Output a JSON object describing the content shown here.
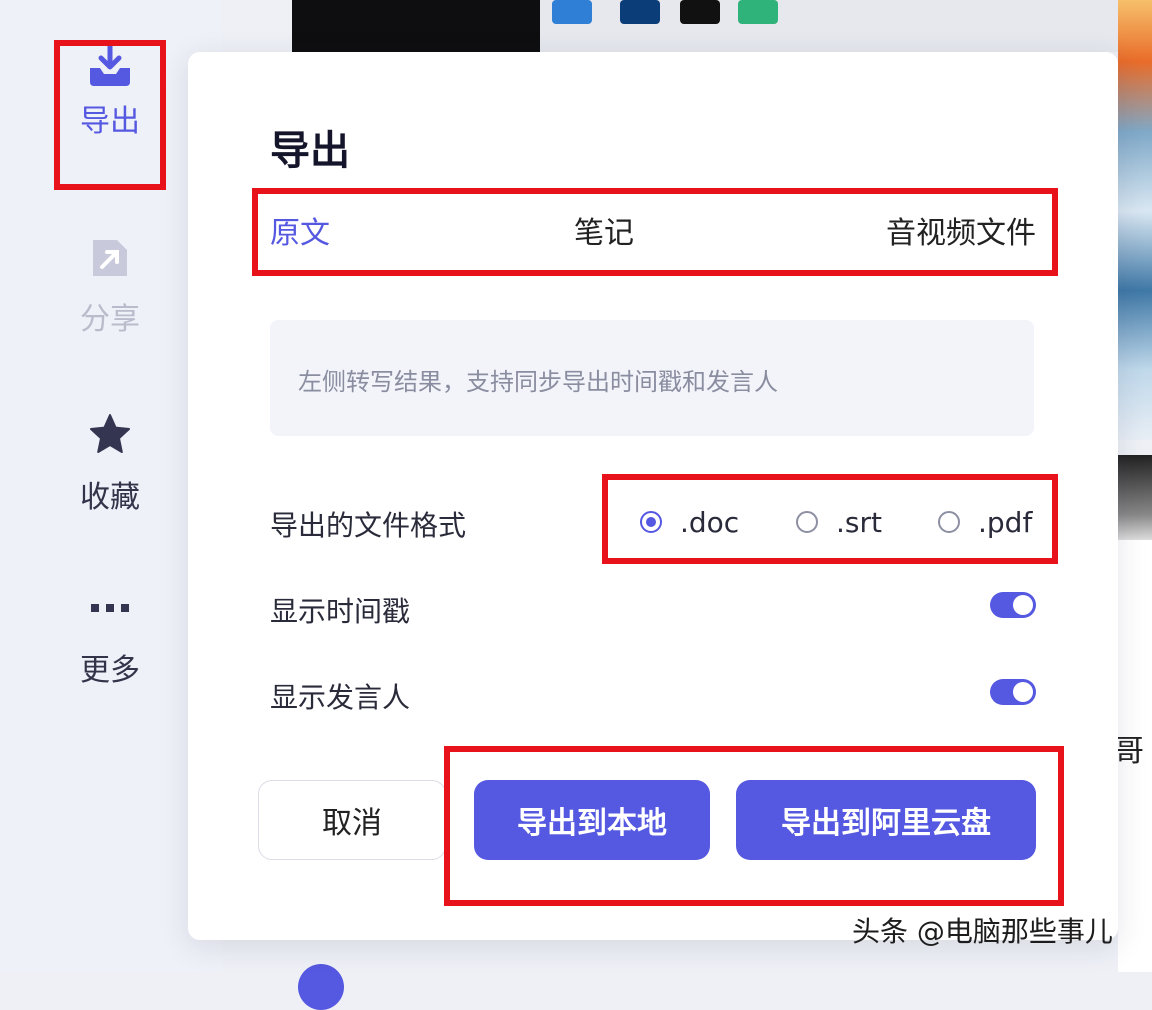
{
  "sidebar": {
    "items": [
      {
        "label": "导出",
        "icon": "download-tray-icon",
        "active": true
      },
      {
        "label": "分享",
        "icon": "share-arrow-icon",
        "disabled": true
      },
      {
        "label": "收藏",
        "icon": "star-icon"
      },
      {
        "label": "更多",
        "icon": "more-dots-icon"
      }
    ]
  },
  "dialog": {
    "title": "导出",
    "tabs": [
      {
        "label": "原文",
        "active": true
      },
      {
        "label": "笔记"
      },
      {
        "label": "音视频文件"
      }
    ],
    "description": "左侧转写结果，支持同步导出时间戳和发言人",
    "format": {
      "label": "导出的文件格式",
      "options": [
        ".doc",
        ".srt",
        ".pdf"
      ],
      "selected": ".doc"
    },
    "show_timestamp": {
      "label": "显示时间戳",
      "enabled": true
    },
    "show_speaker": {
      "label": "显示发言人",
      "enabled": true
    },
    "buttons": {
      "cancel": "取消",
      "export_local": "导出到本地",
      "export_cloud": "导出到阿里云盘"
    }
  },
  "background": {
    "partial_heading_glyph": "哥"
  },
  "watermark": "头条 @电脑那些事儿",
  "colors": {
    "accent": "#5558e0",
    "annotation_red": "#e8131a",
    "muted_text": "#8a8da0"
  }
}
